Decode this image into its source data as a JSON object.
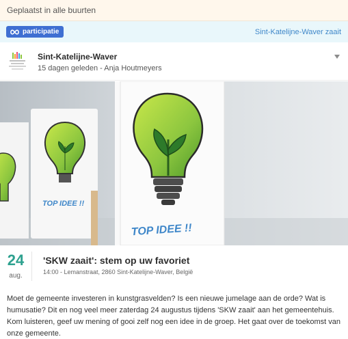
{
  "banner": {
    "text": "Geplaatst in alle buurten"
  },
  "tagbar": {
    "tag_label": "participatie",
    "tag_icon": "infinity-icon",
    "location": "Sint-Katelijne-Waver zaait"
  },
  "post": {
    "author": "Sint-Katelijne-Waver",
    "meta": "15 dagen geleden - Anja Houtmeyers",
    "photo": {
      "sign_text": "TOP IDEE !!"
    }
  },
  "event": {
    "day": "24",
    "month": "aug.",
    "title": "'SKW zaait': stem op uw favoriet",
    "details": "14:00 - Lemanstraat, 2860 Sint-Katelijne-Waver, België"
  },
  "description": "Moet de gemeente investeren in kunstgrasvelden? Is een nieuwe jumelage aan de orde? Wat is humusatie? Dit en nog veel meer zaterdag 24 augustus tijdens 'SKW zaait' aan het gemeentehuis. Kom luisteren, geef uw mening of gooi zelf nog een idee in de groep. Het gaat over de toekomst van onze gemeente.",
  "colors": {
    "tag": "#3f6fd2",
    "date": "#2ea18f",
    "link": "#3f87c9"
  }
}
